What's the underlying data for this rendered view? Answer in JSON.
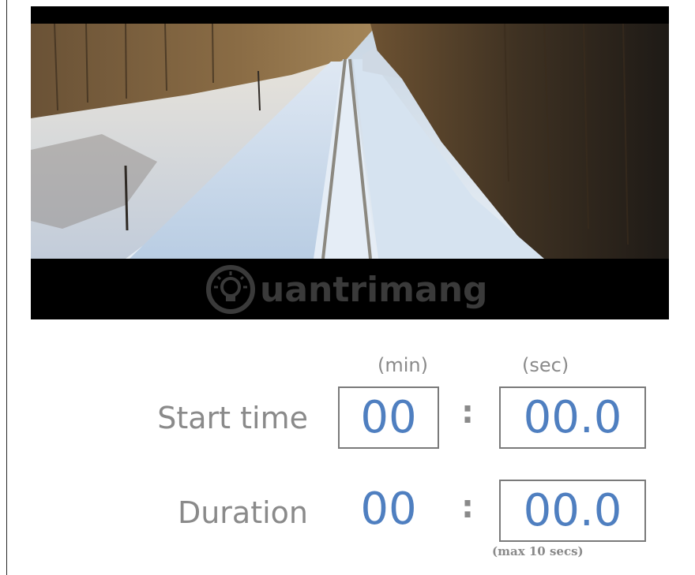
{
  "video": {
    "watermark_text": "uantrimang",
    "watermark_icon": "lightbulb-icon"
  },
  "trim": {
    "min_label": "(min)",
    "sec_label": "(sec)",
    "start": {
      "label": "Start time",
      "minutes": "00",
      "separator": ":",
      "seconds": "00.0"
    },
    "duration": {
      "label": "Duration",
      "minutes": "00",
      "separator": ":",
      "seconds": "00.0",
      "note": "(max 10 secs)"
    }
  },
  "colors": {
    "value_blue": "#4f7fc0",
    "label_gray": "#8a8a8a",
    "box_border": "#7a7a7a"
  }
}
